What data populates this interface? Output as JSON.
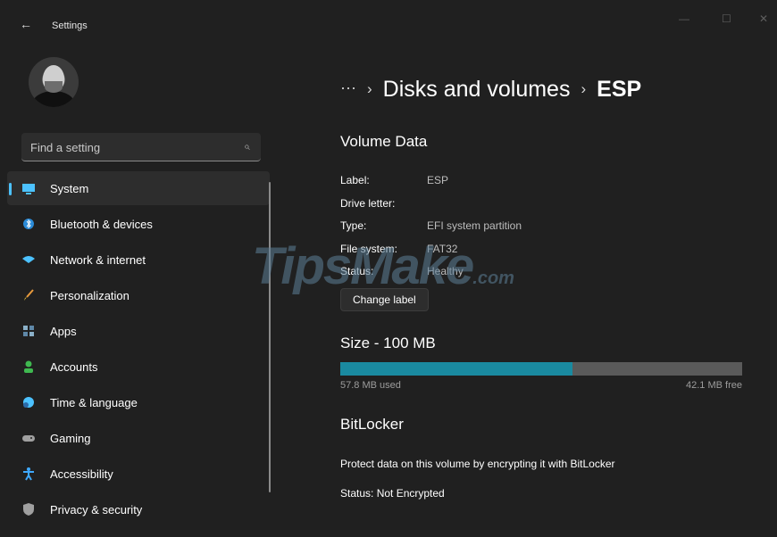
{
  "titlebar": {
    "title": "Settings",
    "back_icon": "←"
  },
  "search": {
    "placeholder": "Find a setting"
  },
  "nav": {
    "items": [
      {
        "label": "System",
        "icon": "system-icon",
        "color": "#4cc2ff"
      },
      {
        "label": "Bluetooth & devices",
        "icon": "bluetooth-icon",
        "color": "#2b8bd8"
      },
      {
        "label": "Network & internet",
        "icon": "network-icon",
        "color": "#4cc2ff"
      },
      {
        "label": "Personalization",
        "icon": "brush-icon",
        "color": "#e89a3c"
      },
      {
        "label": "Apps",
        "icon": "apps-icon",
        "color": "#8ab0c8"
      },
      {
        "label": "Accounts",
        "icon": "accounts-icon",
        "color": "#3fb950"
      },
      {
        "label": "Time & language",
        "icon": "globe-clock-icon",
        "color": "#4cc2ff"
      },
      {
        "label": "Gaming",
        "icon": "gamepad-icon",
        "color": "#a0a0a0"
      },
      {
        "label": "Accessibility",
        "icon": "accessibility-icon",
        "color": "#3fa9ff"
      },
      {
        "label": "Privacy & security",
        "icon": "shield-icon",
        "color": "#a0a0a0"
      }
    ]
  },
  "breadcrumb": {
    "ellipsis": "···",
    "sep": "›",
    "parent": "Disks and volumes",
    "current": "ESP"
  },
  "volume": {
    "heading": "Volume Data",
    "properties": [
      {
        "key": "Label:",
        "value": "ESP"
      },
      {
        "key": "Drive letter:",
        "value": ""
      },
      {
        "key": "Type:",
        "value": "EFI system partition"
      },
      {
        "key": "File system:",
        "value": "FAT32"
      },
      {
        "key": "Status:",
        "value": "Healthy"
      }
    ],
    "change_label_button": "Change label"
  },
  "size": {
    "heading": "Size - 100 MB",
    "used_fraction": 0.578,
    "used": "57.8 MB used",
    "free": "42.1 MB free"
  },
  "bitlocker": {
    "heading": "BitLocker",
    "description": "Protect data on this volume by encrypting it with BitLocker",
    "status": "Status: Not Encrypted"
  },
  "watermark": {
    "text": "TipsMake",
    "suffix": ".com"
  }
}
